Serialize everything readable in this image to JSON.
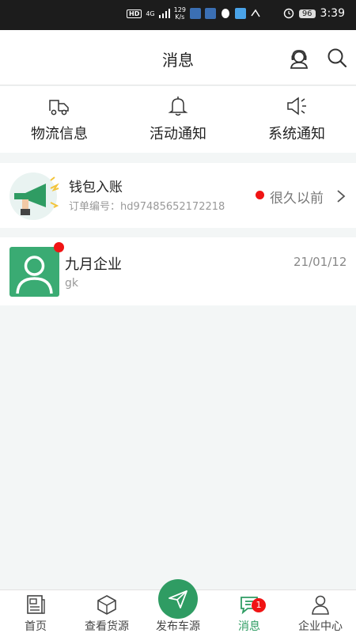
{
  "status_bar": {
    "left_badge": "HD",
    "network": "4G",
    "speed": "129",
    "speed_unit": "K/s",
    "battery": "96",
    "time": "3:39"
  },
  "header": {
    "title": "消息",
    "icons": [
      "customer-service-icon",
      "search-icon"
    ]
  },
  "categories": [
    {
      "label": "物流信息",
      "icon": "truck-icon"
    },
    {
      "label": "活动通知",
      "icon": "bell-icon"
    },
    {
      "label": "系统通知",
      "icon": "speaker-icon"
    }
  ],
  "wallet_message": {
    "title": "钱包入账",
    "subtitle": "订单编号：hd97485652172218",
    "time": "很久以前",
    "icon": "megaphone-icon"
  },
  "company_message": {
    "name": "九月企业",
    "preview": "gk",
    "date": "21/01/12",
    "icon": "avatar-icon"
  },
  "tabbar": {
    "items": [
      {
        "label": "首页",
        "icon": "home-icon"
      },
      {
        "label": "查看货源",
        "icon": "box-icon"
      },
      {
        "label": "发布车源",
        "icon": "send-icon"
      },
      {
        "label": "消息",
        "icon": "message-icon",
        "badge": "1"
      },
      {
        "label": "企业中心",
        "icon": "user-icon"
      }
    ],
    "active_color": "#2f9c63"
  }
}
